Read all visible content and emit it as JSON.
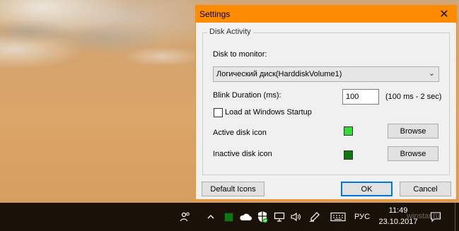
{
  "dialog": {
    "title": "Settings",
    "close_glyph": "✕",
    "group_label": "Disk Activity",
    "disk_label": "Disk to monitor:",
    "disk_value": "Логический диск(HarddiskVolume1)",
    "blink_label": "Blink Duration (ms):",
    "blink_value": "100",
    "blink_hint": "(100 ms - 2 sec)",
    "startup_label": "Load at Windows Startup",
    "startup_checked": false,
    "active_label": "Active disk icon",
    "active_color": "#33dd33",
    "inactive_label": "Inactive disk icon",
    "inactive_color": "#0a7a0a",
    "browse_label": "Browse",
    "default_icons_label": "Default Icons",
    "ok_label": "OK",
    "cancel_label": "Cancel",
    "accent_color": "#ff8c00"
  },
  "taskbar": {
    "language": "РУС",
    "time": "11:49",
    "date": "23.10.2017",
    "watermark": "winstar.ru",
    "icons": [
      "people-icon",
      "chevron-up-icon",
      "disk-activity-icon",
      "onedrive-icon",
      "defender-icon",
      "network-icon",
      "volume-icon",
      "pen-icon",
      "keyboard-icon",
      "notifications-icon"
    ]
  }
}
